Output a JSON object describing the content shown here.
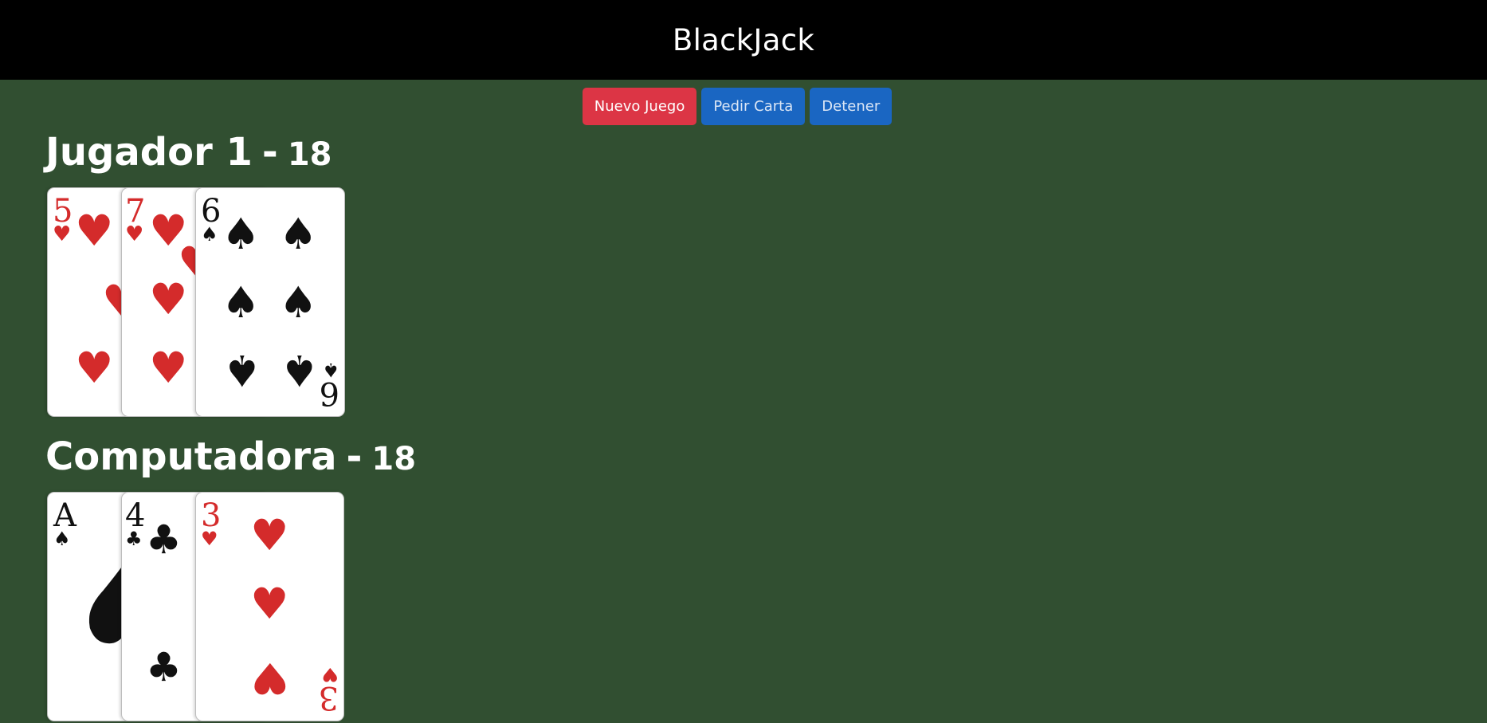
{
  "app": {
    "title": "BlackJack"
  },
  "controls": {
    "new_game": "Nuevo Juego",
    "hit": "Pedir Carta",
    "stand": "Detener"
  },
  "players": [
    {
      "name": "Jugador 1",
      "separator": "-",
      "score": "18",
      "cards": [
        {
          "rank": "5",
          "suit": "hearts",
          "suit_symbol": "♥",
          "color": "#d42b2b"
        },
        {
          "rank": "7",
          "suit": "hearts",
          "suit_symbol": "♥",
          "color": "#d42b2b"
        },
        {
          "rank": "6",
          "suit": "spades",
          "suit_symbol": "♠",
          "color": "#111111"
        }
      ]
    },
    {
      "name": "Computadora",
      "separator": "-",
      "score": "18",
      "cards": [
        {
          "rank": "A",
          "suit": "spades",
          "suit_symbol": "♠",
          "color": "#111111"
        },
        {
          "rank": "4",
          "suit": "clubs",
          "suit_symbol": "♣",
          "color": "#111111"
        },
        {
          "rank": "3",
          "suit": "hearts",
          "suit_symbol": "♥",
          "color": "#d42b2b"
        }
      ]
    }
  ],
  "colors": {
    "table": "#314f31",
    "header": "#000000",
    "danger": "#dc3545",
    "primary": "#1a66c2"
  }
}
